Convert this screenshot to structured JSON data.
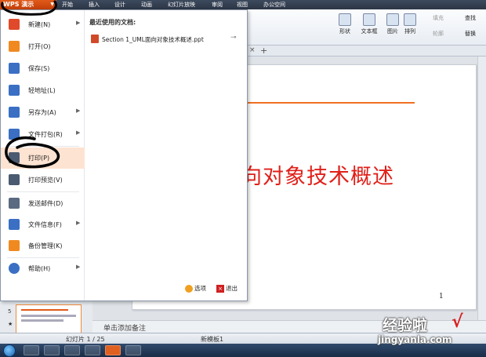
{
  "app": {
    "name": "WPS 演示",
    "menu_tabs": [
      "开始",
      "插入",
      "设计",
      "动画",
      "幻灯片放映",
      "审阅",
      "视图",
      "办公空间"
    ]
  },
  "ribbon": {
    "shapes": "形状",
    "textbox": "文本框",
    "picture": "图片",
    "arrange": "排列",
    "fill": "填充",
    "outline": "轮廓",
    "find": "查找",
    "replace": "替换"
  },
  "file_menu": {
    "items": [
      {
        "label": "新建(N)",
        "icon": "new-icon",
        "color": "#e04a2a",
        "arrow": true
      },
      {
        "label": "打开(O)",
        "icon": "open-folder-icon",
        "color": "#f08a20",
        "arrow": false
      },
      {
        "label": "保存(S)",
        "icon": "save-icon",
        "color": "#3a6fc4",
        "arrow": false
      },
      {
        "label": "轻地址(L)",
        "icon": "link-icon",
        "color": "#3a6fc4",
        "arrow": false
      },
      {
        "label": "另存为(A)",
        "icon": "save-as-icon",
        "color": "#3a6fc4",
        "arrow": true
      },
      {
        "label": "文件打包(R)",
        "icon": "package-icon",
        "color": "#3a6fc4",
        "arrow": true
      },
      {
        "label": "打印(P)",
        "icon": "print-icon",
        "color": "#4a5a70",
        "arrow": false
      },
      {
        "label": "打印预览(V)",
        "icon": "print-preview-icon",
        "color": "#4a5a70",
        "arrow": false
      },
      {
        "label": "发送邮件(D)",
        "icon": "mail-icon",
        "color": "#5a6a80",
        "arrow": false
      },
      {
        "label": "文件信息(F)",
        "icon": "file-info-icon",
        "color": "#3a6fc4",
        "arrow": true
      },
      {
        "label": "备份管理(K)",
        "icon": "backup-icon",
        "color": "#f08a20",
        "arrow": false
      },
      {
        "label": "帮助(H)",
        "icon": "help-icon",
        "color": "#3a6fc4",
        "arrow": true
      }
    ],
    "recent_title": "最近使用的文档:",
    "recent_files": [
      "Section 1_UML面向对象技术概述.ppt"
    ],
    "options_label": "选项",
    "exit_label": "退出"
  },
  "slide": {
    "title": "向对象技术概述",
    "page_number": "1"
  },
  "thumbnails": {
    "slide_number": "5",
    "star": "★"
  },
  "notes": {
    "placeholder": "单击添加备注"
  },
  "status": {
    "slide_info": "幻灯片 1 / 25",
    "template": "新模板1"
  },
  "watermark": {
    "main": "经验啦",
    "check": "√",
    "url": "jingyanla.com"
  }
}
